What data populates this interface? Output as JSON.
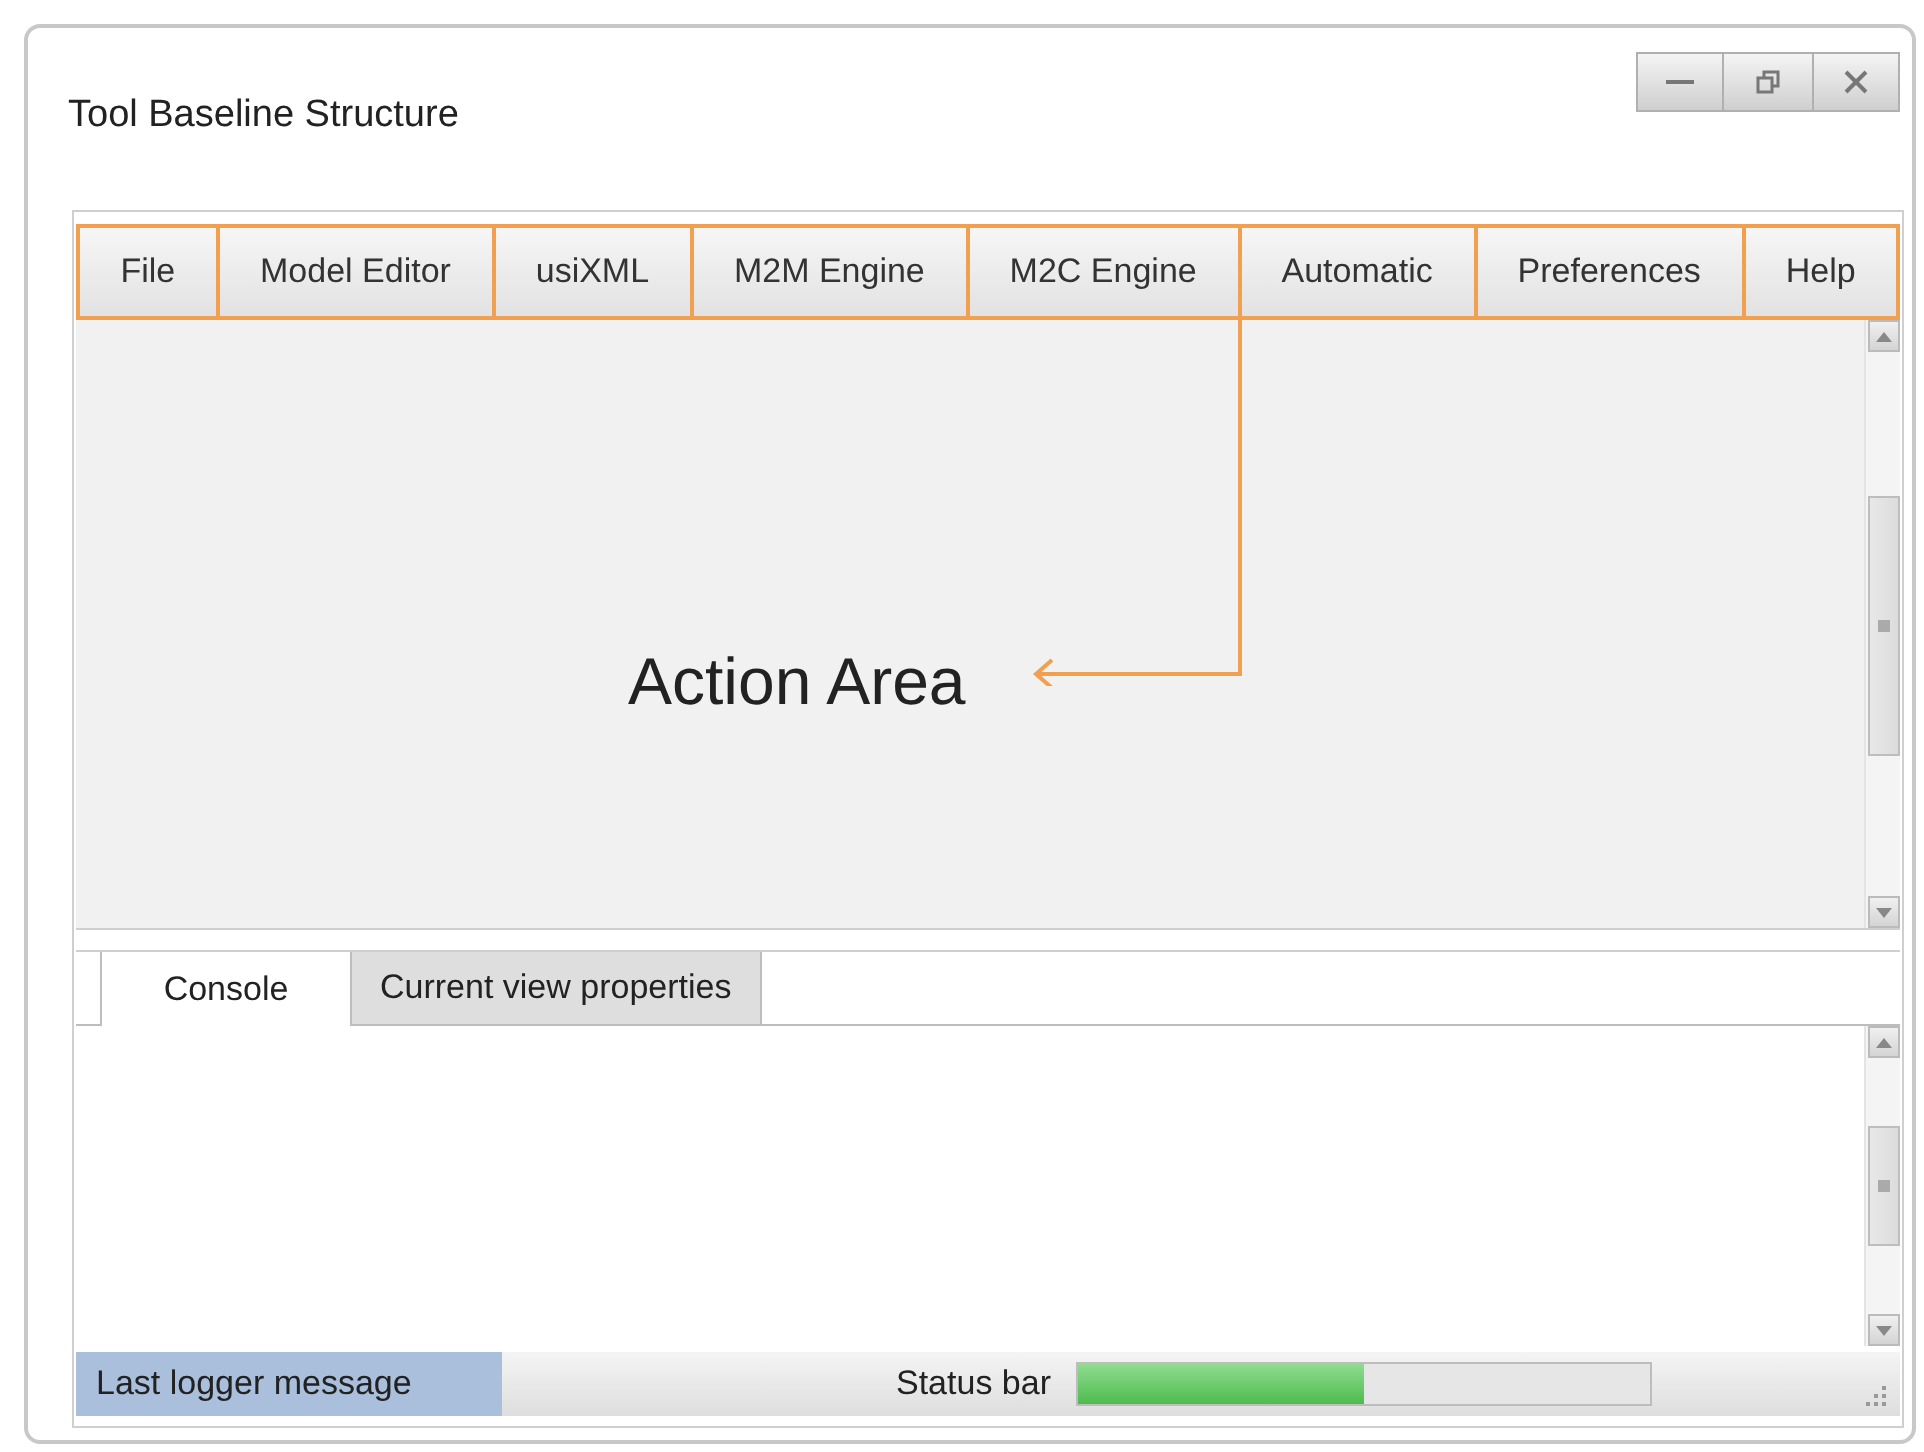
{
  "window": {
    "title": "Tool Baseline Structure"
  },
  "menu": [
    {
      "label": "File"
    },
    {
      "label": "Model Editor"
    },
    {
      "label": "usiXML"
    },
    {
      "label": "M2M Engine"
    },
    {
      "label": "M2C Engine"
    },
    {
      "label": "Automatic"
    },
    {
      "label": "Preferences"
    },
    {
      "label": "Help"
    }
  ],
  "action_area": {
    "label": "Action Area"
  },
  "tabs": [
    {
      "label": "Console",
      "selected": true
    },
    {
      "label": "Current view properties",
      "selected": false
    }
  ],
  "status_bar": {
    "message": "Last logger message",
    "label": "Status bar",
    "level": 0.5
  }
}
